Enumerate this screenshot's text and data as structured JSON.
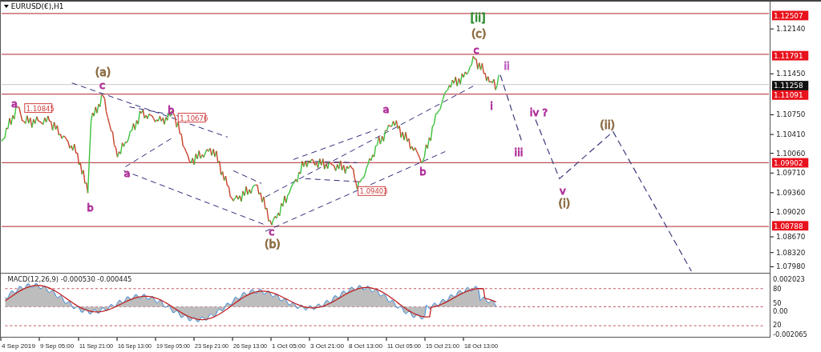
{
  "symbol_label": "EURUSD(€),H1",
  "levels": [
    {
      "price": "1.12507",
      "kind": "resistance"
    },
    {
      "price": "1.11791",
      "kind": "resistance"
    },
    {
      "price": "1.11258",
      "kind": "current"
    },
    {
      "price": "1.11091",
      "kind": "resistance"
    },
    {
      "price": "1.09902",
      "kind": "resistance"
    },
    {
      "price": "1.08788",
      "kind": "resistance"
    }
  ],
  "price_ticks": [
    "1.12140",
    "1.11450",
    "1.10750",
    "1.10410",
    "1.10060",
    "1.09710",
    "1.09360",
    "1.09020",
    "1.08670",
    "1.08320",
    "1.07980"
  ],
  "price_tags": [
    "1.10845",
    "1.10676",
    "1.09403"
  ],
  "wave_labels": [
    {
      "text": "[ii]",
      "color": "#2e8b2e"
    },
    {
      "text": "(c)",
      "color": "#8b6b42"
    },
    {
      "text": "c",
      "color": "#b0309a"
    },
    {
      "text": "ii",
      "color": "#c060c0"
    },
    {
      "text": "i",
      "color": "#b0309a"
    },
    {
      "text": "a",
      "color": "#b0309a"
    },
    {
      "text": "b",
      "color": "#b0309a"
    },
    {
      "text": "iii",
      "color": "#b0309a"
    },
    {
      "text": "iv ?",
      "color": "#b0309a"
    },
    {
      "text": "(ii)",
      "color": "#8b6b42"
    },
    {
      "text": "v",
      "color": "#b0309a"
    },
    {
      "text": "(i)",
      "color": "#8b6b42"
    },
    {
      "text": "(a)",
      "color": "#8b6b42"
    },
    {
      "text": "c",
      "color": "#b0309a"
    },
    {
      "text": "a",
      "color": "#b0309a"
    },
    {
      "text": "b",
      "color": "#b0309a"
    },
    {
      "text": "b",
      "color": "#b0309a"
    },
    {
      "text": "a",
      "color": "#b0309a"
    },
    {
      "text": "c",
      "color": "#b0309a"
    },
    {
      "text": "(b)",
      "color": "#8b6b42"
    }
  ],
  "macd": {
    "title": "MACD(12,26,9) -0.000530 -0.000445",
    "ticks": [
      "0.002023",
      "80",
      "50",
      "0.00",
      "20",
      "-0.002065"
    ]
  },
  "time_ticks": [
    "4 Sep 2019",
    "9 Sep 05:00",
    "11 Sep 21:00",
    "16 Sep 13:00",
    "19 Sep 05:00",
    "23 Sep 21:00",
    "26 Sep 13:00",
    "1 Oct 05:00",
    "3 Oct 21:00",
    "8 Oct 13:00",
    "11 Oct 05:00",
    "15 Oct 21:00",
    "18 Oct 13:00"
  ]
}
